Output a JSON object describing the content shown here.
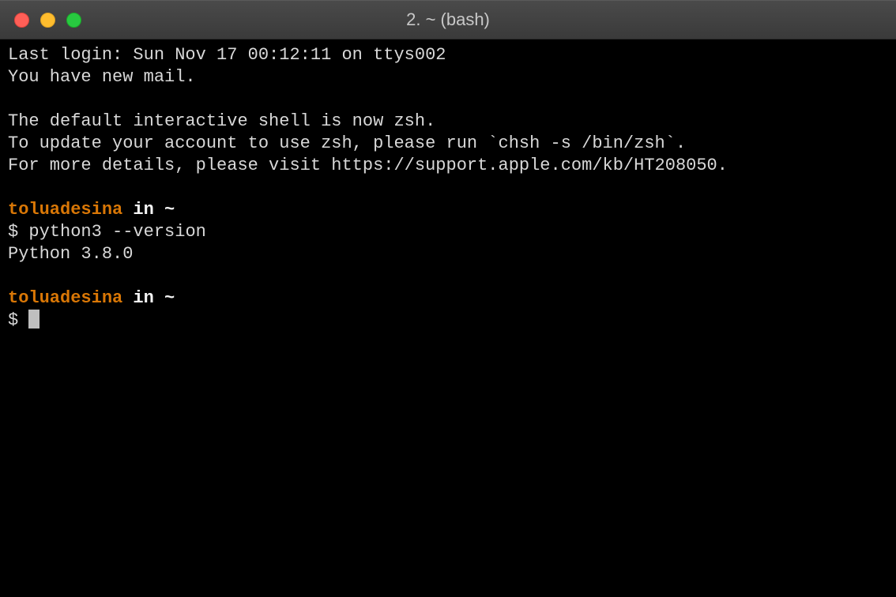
{
  "window": {
    "title": "2. ~ (bash)"
  },
  "terminal": {
    "motd_line1": "Last login: Sun Nov 17 00:12:11 on ttys002",
    "motd_line2": "You have new mail.",
    "motd_line3": "The default interactive shell is now zsh.",
    "motd_line4": "To update your account to use zsh, please run `chsh -s /bin/zsh`.",
    "motd_line5": "For more details, please visit https://support.apple.com/kb/HT208050.",
    "prompt1": {
      "user": "toluadesina",
      "connector": " in ",
      "path": "~",
      "symbol": "$ ",
      "command": "python3 --version"
    },
    "output1": "Python 3.8.0",
    "prompt2": {
      "user": "toluadesina",
      "connector": " in ",
      "path": "~",
      "symbol": "$ "
    }
  }
}
